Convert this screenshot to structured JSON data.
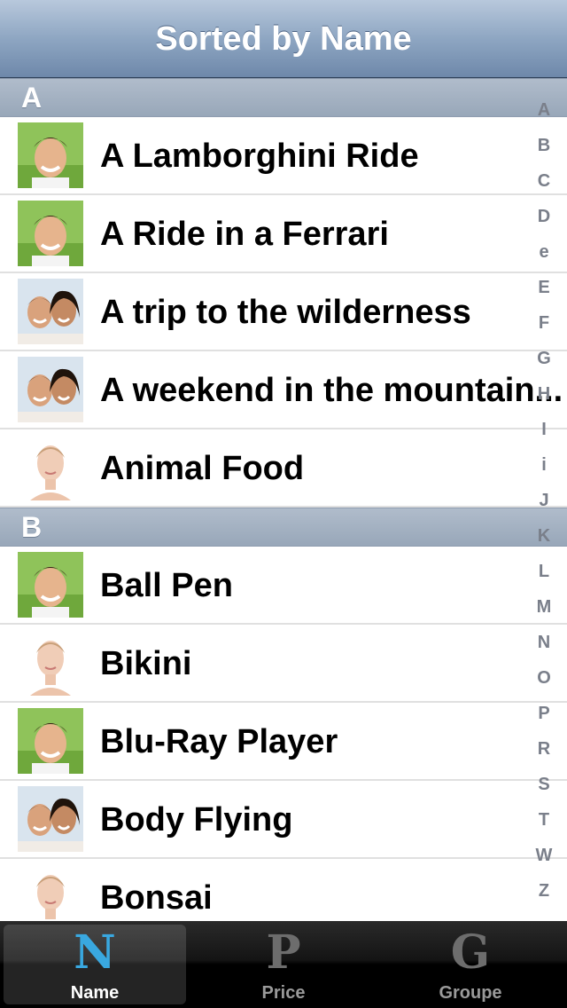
{
  "nav": {
    "title": "Sorted by Name"
  },
  "sections": [
    {
      "header": "A",
      "rows": [
        {
          "label": "A Lamborghini Ride",
          "thumb": "man-portrait"
        },
        {
          "label": "A Ride in a Ferrari",
          "thumb": "man-portrait"
        },
        {
          "label": "A trip to the wilderness",
          "thumb": "couple-portrait"
        },
        {
          "label": "A weekend in the mountain...",
          "thumb": "couple-portrait"
        },
        {
          "label": "Animal Food",
          "thumb": "woman-portrait"
        }
      ]
    },
    {
      "header": "B",
      "rows": [
        {
          "label": "Ball Pen",
          "thumb": "man-portrait"
        },
        {
          "label": "Bikini",
          "thumb": "woman-portrait"
        },
        {
          "label": "Blu-Ray Player",
          "thumb": "man-portrait"
        },
        {
          "label": "Body Flying",
          "thumb": "couple-portrait"
        },
        {
          "label": "Bonsai",
          "thumb": "woman-portrait"
        }
      ]
    }
  ],
  "index_letters": [
    "A",
    "B",
    "C",
    "D",
    "e",
    "E",
    "F",
    "G",
    "H",
    "I",
    "i",
    "J",
    "K",
    "L",
    "M",
    "N",
    "O",
    "P",
    "R",
    "S",
    "T",
    "W",
    "Z"
  ],
  "tabs": [
    {
      "label": "Name",
      "glyph": "N",
      "selected": true,
      "icon": "name-ornament-icon"
    },
    {
      "label": "Price",
      "glyph": "P",
      "selected": false,
      "icon": "price-ornament-icon"
    },
    {
      "label": "Groupe",
      "glyph": "G",
      "selected": false,
      "icon": "groupe-ornament-icon"
    }
  ],
  "colors": {
    "nav_accent": "#7d95b5",
    "tab_selected_icon": "#39a8e0",
    "tab_label": "#ffffff",
    "tab_inactive_label": "#9a9a9a"
  }
}
